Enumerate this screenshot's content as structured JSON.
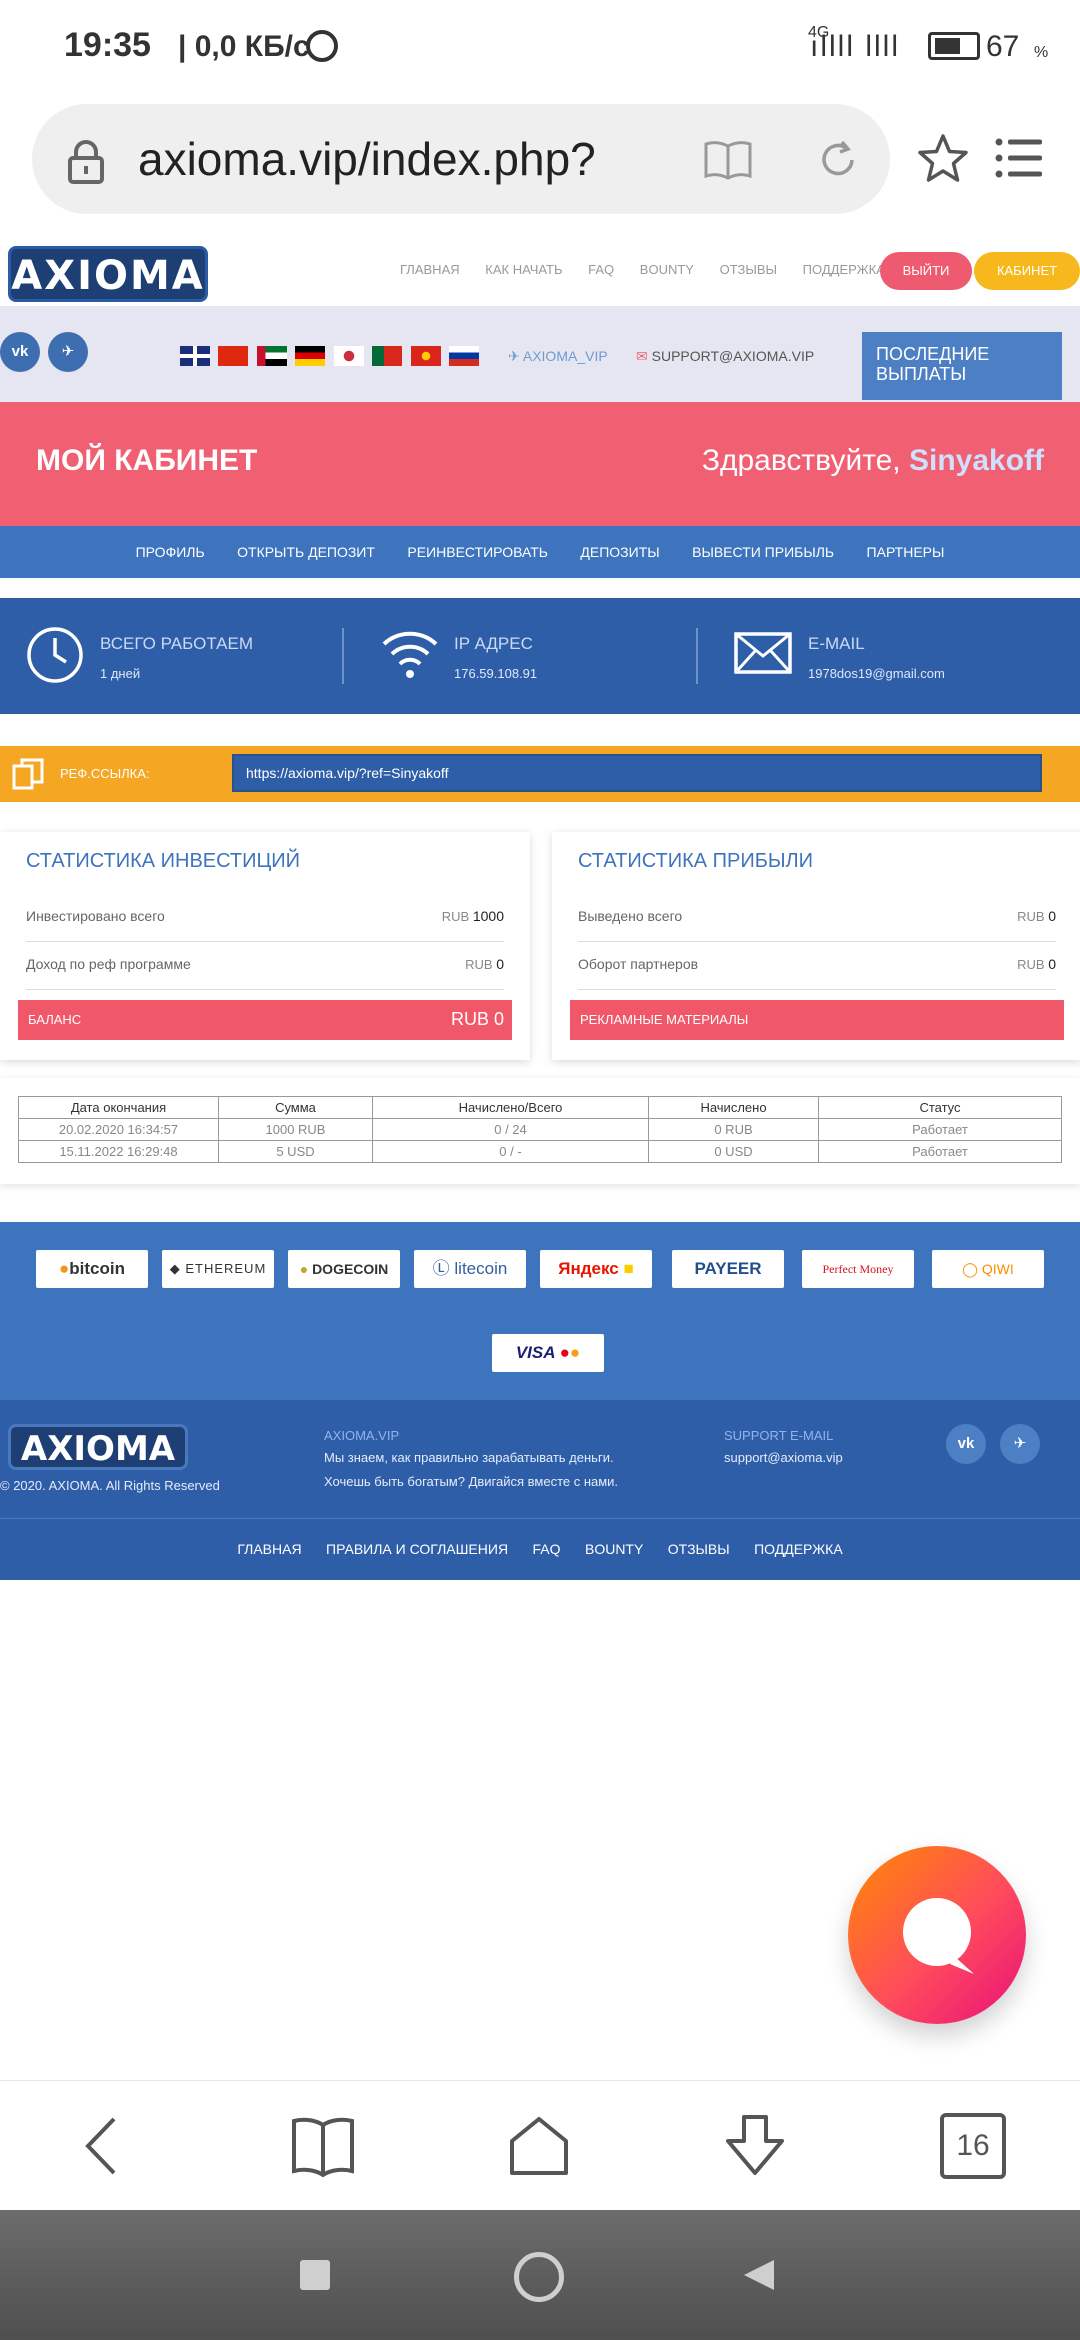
{
  "status_bar": {
    "time": "19:35",
    "speed": "| 0,0 КБ/с",
    "network": "4G",
    "signal": "ıllll llll",
    "battery_percent": "67",
    "percent_sign": "%",
    "battery_level": 0.67
  },
  "browser": {
    "url": "axioma.vip/index.php?",
    "tab_count": "16"
  },
  "site": {
    "logo_text": "AXIOMA",
    "nav": [
      "ГЛАВНАЯ",
      "КАК НАЧАТЬ",
      "FAQ",
      "BOUNTY",
      "ОТЗЫВЫ",
      "ПОДДЕРЖКА"
    ],
    "logout_label": "ВЫЙТИ",
    "cabinet_label": "КАБИНЕТ",
    "social": {
      "vk": "vk",
      "telegram": "✈"
    },
    "telegram_handle": "AXIOMA_VIP",
    "support_email": "SUPPORT@AXIOMA.VIP",
    "payouts_label_1": "ПОСЛЕДНИЕ",
    "payouts_label_2": "ВЫПЛАТЫ"
  },
  "cabinet": {
    "title": "МОЙ КАБИНЕТ",
    "greeting": "Здравствуйте, ",
    "username": "Sinyakoff",
    "menu": [
      "ПРОФИЛЬ",
      "ОТКРЫТЬ ДЕПОЗИТ",
      "РЕИНВЕСТИРОВАТЬ",
      "ДЕПОЗИТЫ",
      "ВЫВЕСТИ ПРИБЫЛЬ",
      "ПАРТНЕРЫ"
    ]
  },
  "info": {
    "work_label": "ВСЕГО РАБОТАЕМ",
    "work_value": "1 дней",
    "ip_label": "IP АДРЕС",
    "ip_value": "176.59.108.91",
    "email_label": "E-MAIL",
    "email_value": "1978dos19@gmail.com"
  },
  "ref": {
    "label": "РЕФ.ССЫЛКА:",
    "link": "https://axioma.vip/?ref=Sinyakoff"
  },
  "invest_stats": {
    "title": "СТАТИСТИКА ИНВЕСТИЦИЙ",
    "row1_label": "Инвестировано всего",
    "row1_cur": "RUB",
    "row1_val": "1000",
    "row2_label": "Доход по реф программе",
    "row2_cur": "RUB",
    "row2_val": "0",
    "balance_label": "БАЛАНС",
    "balance_value": "RUB 0"
  },
  "profit_stats": {
    "title": "СТАТИСТИКА ПРИБЫЛИ",
    "row1_label": "Выведено всего",
    "row1_cur": "RUB",
    "row1_val": "0",
    "row2_label": "Оборот партнеров",
    "row2_cur": "RUB",
    "row2_val": "0",
    "promo_label": "РЕКЛАМНЫЕ МАТЕРИАЛЫ"
  },
  "deposits": {
    "headers": [
      "Дата окончания",
      "Сумма",
      "Начислено/Всего",
      "Начислено",
      "Статус"
    ],
    "rows": [
      [
        "20.02.2020 16:34:57",
        "1000 RUB",
        "0 / 24",
        "0 RUB",
        "Работает"
      ],
      [
        "15.11.2022 16:29:48",
        "5 USD",
        "0 / -",
        "0 USD",
        "Работает"
      ]
    ]
  },
  "payments": [
    "bitcoin",
    "ETHEREUM",
    "DOGECOIN",
    "litecoin",
    "Яндекс",
    "PAYEER",
    "Perfect Money",
    "QIWI",
    "VISA"
  ],
  "footer": {
    "logo_text": "AXIOMA",
    "copyright": "© 2020. AXIOMA. All Rights Reserved",
    "brand_head": "AXIOMA.VIP",
    "text1": "Мы знаем, как правильно зарабатывать деньги.",
    "text2": "Хочешь быть богатым? Двигайся вместе с нами.",
    "support_head": "SUPPORT E-MAIL",
    "support_email": "support@axioma.vip",
    "nav": [
      "ГЛАВНАЯ",
      "ПРАВИЛА И СОГЛАШЕНИЯ",
      "FAQ",
      "BOUNTY",
      "ОТЗЫВЫ",
      "ПОДДЕРЖКА"
    ]
  },
  "colors": {
    "primary_blue": "#3d74bd",
    "accent_red": "#f05f72",
    "accent_orange": "#f5a623"
  }
}
